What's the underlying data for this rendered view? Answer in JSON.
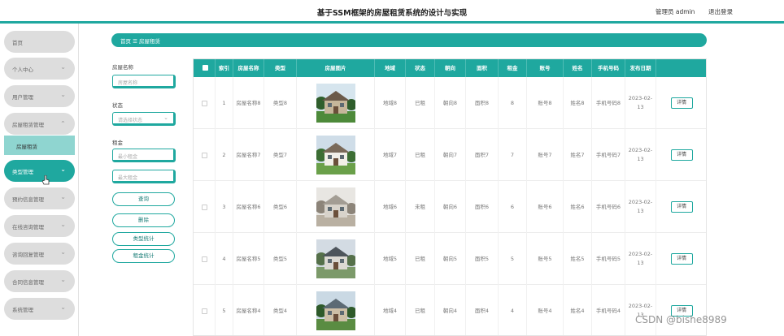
{
  "header": {
    "title": "基于SSM框架的房屋租赁系统的设计与实现",
    "admin": "管理员 admin",
    "logout": "退出登录",
    "accent": "#1fa89f"
  },
  "sidebar": {
    "items": [
      {
        "label": "首页"
      },
      {
        "label": "个人中心"
      },
      {
        "label": "用户管理"
      },
      {
        "label": "房屋租赁管理"
      },
      {
        "label": "类型管理"
      },
      {
        "label": "预约信息管理"
      },
      {
        "label": "在线咨询管理"
      },
      {
        "label": "咨询回复管理"
      },
      {
        "label": "合同信息管理"
      },
      {
        "label": "系统管理"
      }
    ],
    "sub_item": "房屋租赁",
    "chevron": "⌄",
    "active": "类型管理"
  },
  "breadcrumb": "首页 ☰ 房屋租赁",
  "filters": {
    "name_label": "房屋名称",
    "name_placeholder": "房屋名称",
    "status_label": "状态",
    "status_placeholder": "请选择状态",
    "rent_label": "租金",
    "min_placeholder": "最小租金",
    "max_placeholder": "最大租金",
    "buttons": [
      "查询",
      "删除",
      "类型统计",
      "租金统计"
    ]
  },
  "table": {
    "headers": [
      "",
      "索引",
      "房屋名称",
      "类型",
      "房屋图片",
      "地域",
      "状态",
      "朝向",
      "面积",
      "租金",
      "账号",
      "姓名",
      "手机号码",
      "发布日期",
      ""
    ],
    "rows": [
      {
        "index": "1",
        "name": "房屋名称8",
        "type": "类型8",
        "region": "地域8",
        "status": "已租",
        "orient": "朝向8",
        "area": "面积8",
        "rent": "8",
        "account": "账号8",
        "person": "姓名8",
        "phone": "手机号码8",
        "date": "2023-02-13",
        "action": "详情",
        "image": "villa-with-pine-trees"
      },
      {
        "index": "2",
        "name": "房屋名称7",
        "type": "类型7",
        "region": "地域7",
        "status": "已租",
        "orient": "朝向7",
        "area": "面积7",
        "rent": "7",
        "account": "账号7",
        "person": "姓名7",
        "phone": "手机号码7",
        "date": "2023-02-13",
        "action": "详情",
        "image": "white-villa"
      },
      {
        "index": "3",
        "name": "房屋名称6",
        "type": "类型6",
        "region": "地域6",
        "status": "未租",
        "orient": "朝向6",
        "area": "面积6",
        "rent": "6",
        "account": "账号6",
        "person": "姓名6",
        "phone": "手机号码6",
        "date": "2023-02-13",
        "action": "详情",
        "image": "interior-room"
      },
      {
        "index": "4",
        "name": "房屋名称5",
        "type": "类型5",
        "region": "地域5",
        "status": "已租",
        "orient": "朝向5",
        "area": "面积5",
        "rent": "5",
        "account": "账号5",
        "person": "姓名5",
        "phone": "手机号码5",
        "date": "2023-02-13",
        "action": "详情",
        "image": "grey-roof-house"
      },
      {
        "index": "5",
        "name": "房屋名称4",
        "type": "类型4",
        "region": "地域4",
        "status": "已租",
        "orient": "朝向4",
        "area": "面积4",
        "rent": "4",
        "account": "账号4",
        "person": "姓名4",
        "phone": "手机号码4",
        "date": "2023-02-13",
        "action": "详情",
        "image": "house-with-trees"
      }
    ]
  },
  "watermark": "CSDN @bishe8989"
}
